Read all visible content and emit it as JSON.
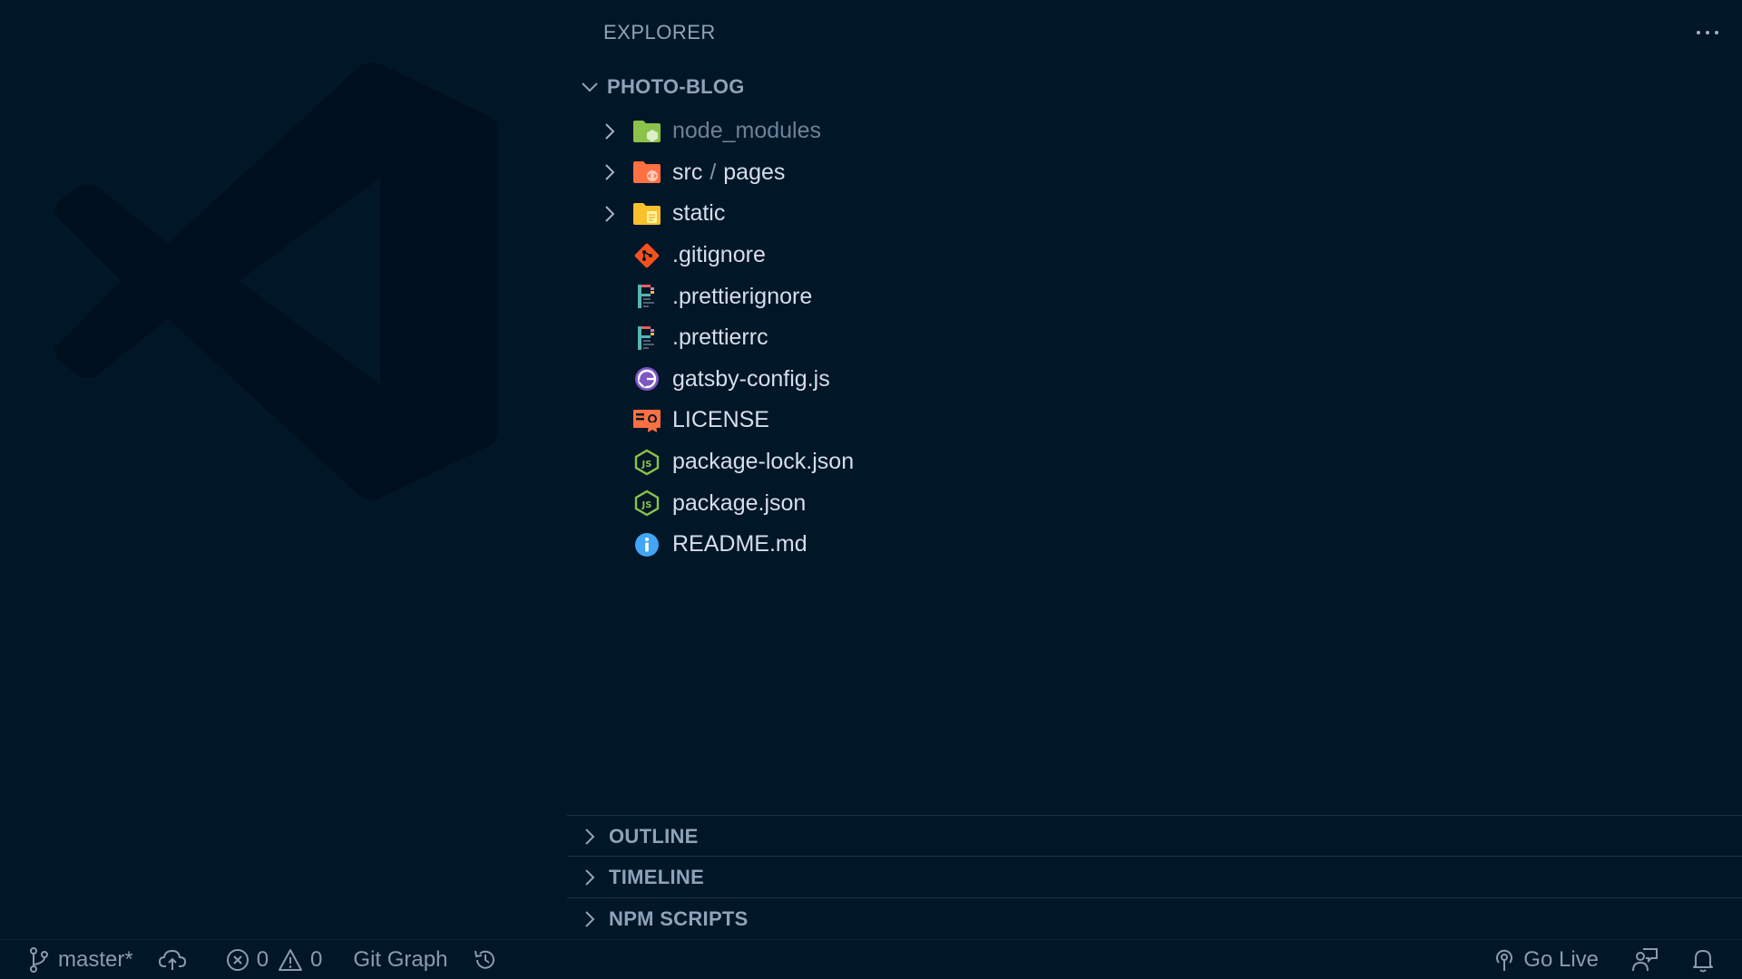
{
  "explorer": {
    "title": "EXPLORER",
    "root_label": "PHOTO-BLOG"
  },
  "tree": [
    {
      "name": "node_modules",
      "kind": "folder",
      "icon": "node-folder-icon",
      "color": "#8bc34a"
    },
    {
      "name": "src",
      "sub": "pages",
      "kind": "folder",
      "icon": "src-folder-icon",
      "color": "#ff7043"
    },
    {
      "name": "static",
      "kind": "folder",
      "icon": "static-folder-icon",
      "color": "#fbc02d"
    },
    {
      "name": ".gitignore",
      "kind": "file",
      "icon": "git-icon",
      "color": "#f4511e"
    },
    {
      "name": ".prettierignore",
      "kind": "file",
      "icon": "prettier-icon"
    },
    {
      "name": ".prettierrc",
      "kind": "file",
      "icon": "prettier-icon"
    },
    {
      "name": "gatsby-config.js",
      "kind": "file",
      "icon": "gatsby-icon",
      "color": "#7e57c2"
    },
    {
      "name": "LICENSE",
      "kind": "file",
      "icon": "license-icon",
      "color": "#ff7043"
    },
    {
      "name": "package-lock.json",
      "kind": "file",
      "icon": "nodejs-icon",
      "color": "#8bc34a"
    },
    {
      "name": "package.json",
      "kind": "file",
      "icon": "nodejs-icon",
      "color": "#8bc34a"
    },
    {
      "name": "README.md",
      "kind": "file",
      "icon": "info-icon",
      "color": "#42a5f5"
    }
  ],
  "sections": {
    "outline": "OUTLINE",
    "timeline": "TIMELINE",
    "npm_scripts": "NPM SCRIPTS"
  },
  "statusbar": {
    "branch": "master*",
    "errors": "0",
    "warnings": "0",
    "git_graph": "Git Graph",
    "go_live": "Go Live"
  }
}
